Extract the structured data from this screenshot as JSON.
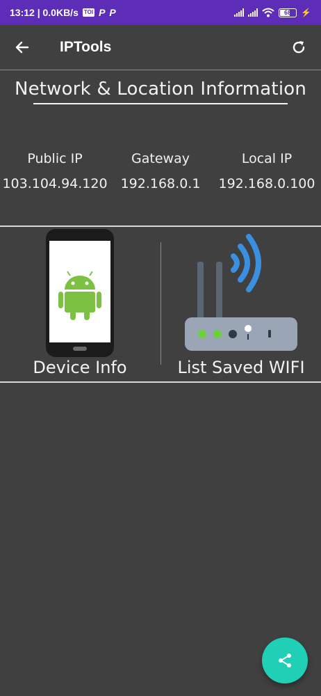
{
  "status_bar": {
    "time_speed": "13:12 | 0.0KB/s",
    "news_badge": "TOI",
    "p_glyph": "P",
    "battery_percent": "68"
  },
  "app_bar": {
    "title": "IPTools",
    "back_icon": "arrow-left-icon",
    "refresh_icon": "refresh-icon"
  },
  "network_info": {
    "title": "Network & Location Information",
    "columns": [
      {
        "label": "Public IP",
        "value": "103.104.94.120"
      },
      {
        "label": "Gateway",
        "value": "192.168.0.1"
      },
      {
        "label": "Local IP",
        "value": "192.168.0.100"
      }
    ]
  },
  "tools": [
    {
      "label": "Device Info",
      "icon": "android-phone-icon"
    },
    {
      "label": "List Saved WIFI",
      "icon": "wifi-router-icon"
    }
  ],
  "fab": {
    "icon": "share-icon",
    "color": "#1fcfb6"
  },
  "colors": {
    "status_bar": "#5d2db8",
    "background": "#404040",
    "android_green": "#7cc142",
    "wifi_blue": "#3a8fe0"
  }
}
